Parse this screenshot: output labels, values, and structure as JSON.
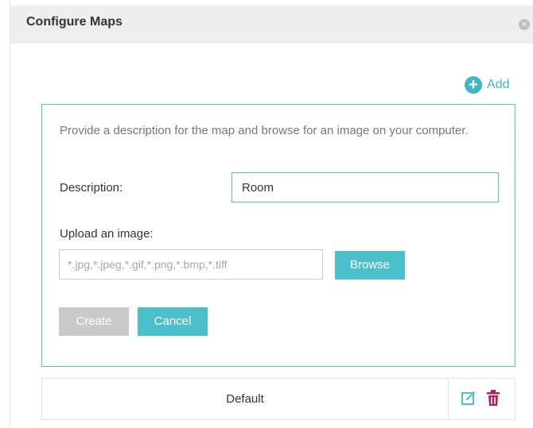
{
  "dialog": {
    "title": "Configure Maps",
    "close_glyph": "×"
  },
  "toolbar": {
    "add_label": "Add",
    "add_glyph": "+"
  },
  "form": {
    "instructions": "Provide a description for the map and browse for an image on your computer.",
    "description_label": "Description:",
    "description_value": "Room",
    "upload_label": "Upload an image:",
    "upload_placeholder": "*.jpg,*.jpeg,*.gif,*.png,*.bmp,*.tiff",
    "browse_label": "Browse",
    "create_label": "Create",
    "cancel_label": "Cancel"
  },
  "maps": [
    {
      "name": "Default"
    }
  ],
  "icons": {
    "close": "close-icon",
    "add": "plus-circle-icon",
    "edit": "edit-icon",
    "delete": "trash-icon"
  },
  "colors": {
    "accent": "#4cbfcd",
    "accent_border": "#5cc1cf",
    "disabled": "#c9c9c9",
    "danger": "#c2185b",
    "header_bg": "#eeeeee"
  }
}
